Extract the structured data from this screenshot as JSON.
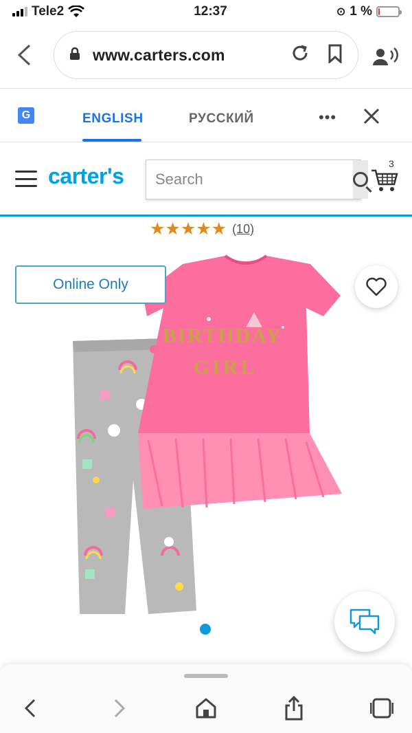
{
  "status_bar": {
    "carrier": "Tele2",
    "time": "12:37",
    "battery": "1 %"
  },
  "browser": {
    "url": "www.carters.com"
  },
  "translate": {
    "active_lang": "ENGLISH",
    "other_lang": "РУССКИЙ",
    "more": "•••"
  },
  "site": {
    "logo": "carter's",
    "search_placeholder": "Search",
    "cart_count": "3"
  },
  "product": {
    "stars": "★★★★★",
    "review_count": "(10)",
    "badge": "Online Only",
    "shirt_text_line1": "BIRTHDAY",
    "shirt_text_line2": "GIRL"
  },
  "colors": {
    "brand": "#00a1de",
    "star": "#e08a1e",
    "shirt": "#fb6e9d",
    "leggings": "#b9b9b9"
  }
}
